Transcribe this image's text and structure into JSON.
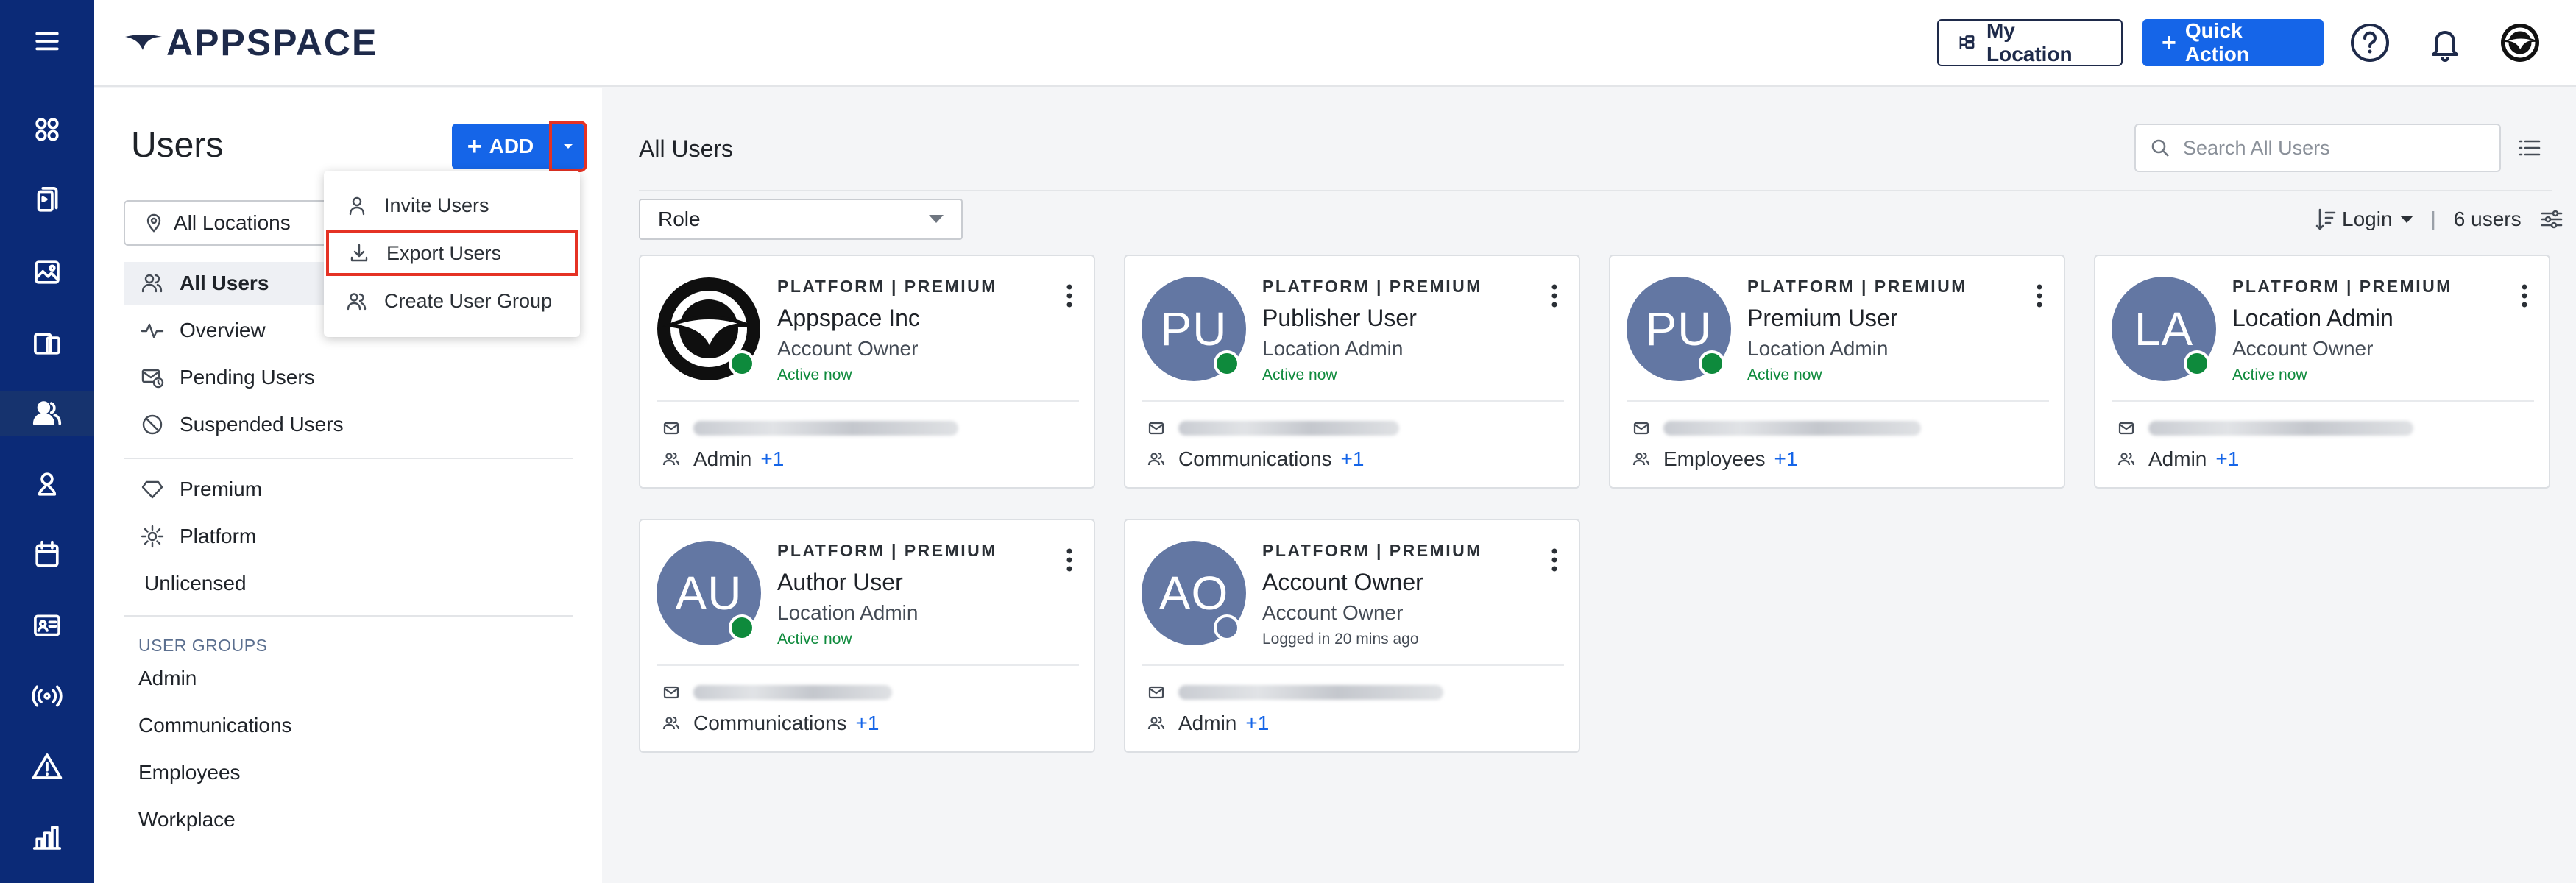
{
  "header": {
    "logo_text": "APPSPACE",
    "my_location_label": "My Location",
    "quick_action_label": "Quick Action"
  },
  "rail": {
    "icons": [
      "menu-icon",
      "dashboard-icon",
      "content-icon",
      "image-icon",
      "channels-icon",
      "users-icon",
      "location-icon",
      "calendar-icon",
      "id-card-icon",
      "broadcast-icon",
      "alert-icon",
      "analytics-icon"
    ]
  },
  "left_panel": {
    "title": "Users",
    "add_label": "ADD",
    "location_filter": "All Locations",
    "nav": [
      "All Users",
      "Overview",
      "Pending Users",
      "Suspended Users"
    ],
    "license_nav": [
      "Premium",
      "Platform",
      "Unlicensed"
    ],
    "user_groups_label": "USER GROUPS",
    "user_groups": [
      "Admin",
      "Communications",
      "Employees",
      "Workplace"
    ]
  },
  "add_menu": {
    "items": [
      "Invite Users",
      "Export Users",
      "Create User Group"
    ]
  },
  "main": {
    "title": "All Users",
    "search_placeholder": "Search All Users",
    "role_filter": "Role",
    "sort_label": "Login",
    "user_count": "6 users"
  },
  "users": [
    {
      "tier": "PLATFORM | PREMIUM",
      "name": "Appspace Inc",
      "role": "Account Owner",
      "status": "Active now",
      "initials": "",
      "group": "Admin",
      "more": "+1"
    },
    {
      "tier": "PLATFORM | PREMIUM",
      "name": "Publisher User",
      "role": "Location Admin",
      "status": "Active now",
      "initials": "PU",
      "group": "Communications",
      "more": "+1"
    },
    {
      "tier": "PLATFORM | PREMIUM",
      "name": "Premium User",
      "role": "Location Admin",
      "status": "Active now",
      "initials": "PU",
      "group": "Employees",
      "more": "+1"
    },
    {
      "tier": "PLATFORM | PREMIUM",
      "name": "Location Admin",
      "role": "Account Owner",
      "status": "Active now",
      "initials": "LA",
      "group": "Admin",
      "more": "+1"
    },
    {
      "tier": "PLATFORM | PREMIUM",
      "name": "Author User",
      "role": "Location Admin",
      "status": "Active now",
      "initials": "AU",
      "group": "Communications",
      "more": "+1"
    },
    {
      "tier": "PLATFORM | PREMIUM",
      "name": "Account Owner",
      "role": "Account Owner",
      "status": "Logged in 20 mins ago",
      "initials": "AO",
      "group": "Admin",
      "more": "+1"
    }
  ],
  "colors": {
    "rail_bg": "#0b2a77",
    "primary": "#1565e8",
    "highlight_outline": "#e53224",
    "active_status": "#0e8a3c",
    "avatar_bg": "#6377a3"
  }
}
